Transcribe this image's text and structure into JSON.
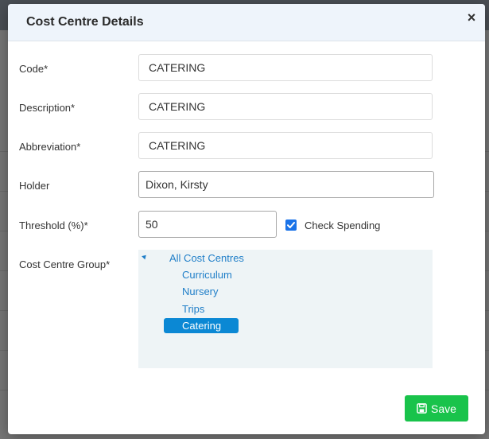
{
  "modal": {
    "title": "Cost Centre Details",
    "close_symbol": "×"
  },
  "form": {
    "code": {
      "label": "Code*",
      "value": "CATERING"
    },
    "description": {
      "label": "Description*",
      "value": "CATERING"
    },
    "abbreviation": {
      "label": "Abbreviation*",
      "value": "CATERING"
    },
    "holder": {
      "label": "Holder",
      "value": "Dixon, Kirsty"
    },
    "threshold": {
      "label": "Threshold (%)*",
      "value": "50"
    },
    "check_spending": {
      "label": "Check Spending",
      "checked": true
    },
    "group": {
      "label": "Cost Centre Group*"
    }
  },
  "tree": {
    "root": "All Cost Centres",
    "children": [
      "Curriculum",
      "Nursery",
      "Trips",
      "Catering"
    ],
    "selected": "Catering"
  },
  "actions": {
    "save_label": "Save"
  },
  "colors": {
    "accent_blue": "#1f7ec8",
    "selected_bg": "#0b88d4",
    "save_green": "#19c34b",
    "header_bg": "#eef4fb"
  },
  "icons": {
    "close": "close-icon",
    "save": "floppy-disk-icon",
    "check": "check-icon",
    "expand": "tree-expand-icon"
  }
}
